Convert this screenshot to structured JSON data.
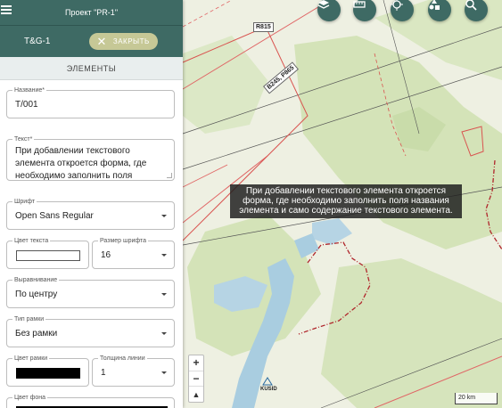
{
  "header": {
    "project_title": "Проект \"PR-1\""
  },
  "layer_bar": {
    "layer_name": "T&G-1",
    "close_label": "ЗАКРЫТЬ"
  },
  "section": {
    "title": "ЭЛЕМЕНТЫ"
  },
  "form": {
    "name": {
      "label": "Название*",
      "value": "T/001"
    },
    "text": {
      "label": "Текст*",
      "value": "При добавлении текстового элемента откроется форма, где необходимо заполнить поля"
    },
    "font": {
      "label": "Шрифт",
      "value": "Open Sans Regular"
    },
    "text_color": {
      "label": "Цвет текста",
      "color": "#ffffff"
    },
    "font_size": {
      "label": "Размер шрифта",
      "value": "16"
    },
    "alignment": {
      "label": "Выравнивание",
      "value": "По центру"
    },
    "frame_type": {
      "label": "Тип рамки",
      "value": "Без рамки"
    },
    "frame_color": {
      "label": "Цвет рамки",
      "color": "#000000"
    },
    "line_width": {
      "label": "Толщина линии",
      "value": "1"
    },
    "bg_color": {
      "label": "Цвет фона",
      "color": "#000000"
    }
  },
  "map": {
    "tooltip": "При добавлении текстового элемента откроется форма, где необходимо заполнить поля названия элемента и само содержание текстового элемента.",
    "road_labels": [
      "R815",
      "B245, P865"
    ],
    "place_label": "KUSID",
    "scale_label": "20 km",
    "zoom_in": "+",
    "zoom_out": "−",
    "compass": "▲",
    "toolbar_icons": [
      "layers-icon",
      "ruler-icon",
      "crosshair-icon",
      "shapes-icon",
      "search-icon"
    ]
  },
  "colors": {
    "accent": "#3e6a64",
    "close_button": "#c6c896",
    "water": "#a9cde0",
    "forest": "#d4e3b8",
    "boundary": "#b0262c"
  }
}
